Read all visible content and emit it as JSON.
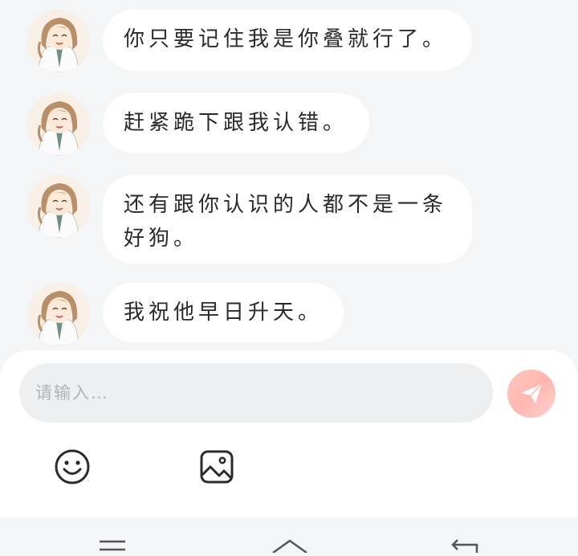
{
  "messages": [
    {
      "text": "你只要记住我是你叠就行了。"
    },
    {
      "text": "赶紧跪下跟我认错。"
    },
    {
      "text": "还有跟你认识的人都不是一条好狗。"
    },
    {
      "text": "我祝他早日升天。"
    }
  ],
  "composer": {
    "placeholder": "请输入…",
    "send_icon": "paper-plane-icon",
    "tools": [
      "smiley-icon",
      "image-icon"
    ]
  },
  "system_nav": [
    "menu-icon",
    "home-icon",
    "back-icon"
  ],
  "colors": {
    "background": "#f4f5f7",
    "bubble": "#ffffff",
    "send_button": "#ffbdb6"
  }
}
